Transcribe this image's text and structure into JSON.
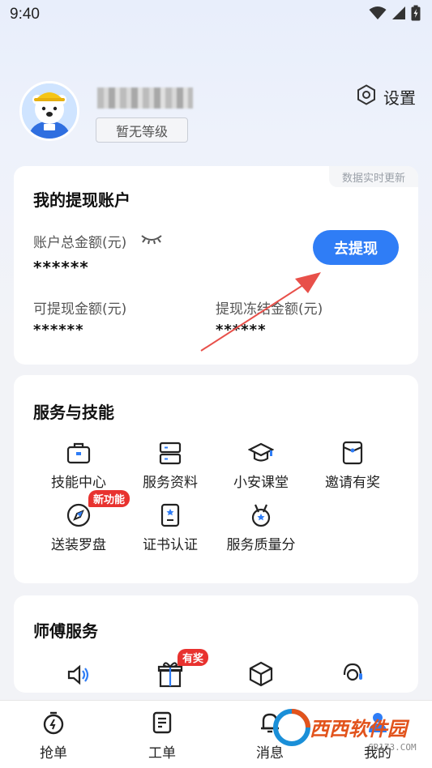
{
  "status_bar": {
    "time": "9:40"
  },
  "profile": {
    "level": "暂无等级",
    "settings_label": "设置"
  },
  "withdraw_account": {
    "title": "我的提现账户",
    "realtime_note": "数据实时更新",
    "total_label": "账户总金额(元)",
    "total_value": "******",
    "withdraw_button": "去提现",
    "available_label": "可提现金额(元)",
    "available_value": "******",
    "frozen_label": "提现冻结金额(元)",
    "frozen_value": "******"
  },
  "services": {
    "title": "服务与技能",
    "new_feature_tag": "新功能",
    "items": [
      {
        "label": "技能中心",
        "icon": "briefcase-icon"
      },
      {
        "label": "服务资料",
        "icon": "server-icon"
      },
      {
        "label": "小安课堂",
        "icon": "graduation-cap-icon"
      },
      {
        "label": "邀请有奖",
        "icon": "invite-card-icon"
      },
      {
        "label": "送装罗盘",
        "icon": "compass-icon"
      },
      {
        "label": "证书认证",
        "icon": "certificate-icon"
      },
      {
        "label": "服务质量分",
        "icon": "medal-icon"
      }
    ]
  },
  "master_services": {
    "title": "师傅服务",
    "award_tag": "有奖",
    "icons": [
      "speaker-icon",
      "gift-icon",
      "box-icon",
      "support-icon"
    ]
  },
  "bottom_nav": {
    "items": [
      {
        "label": "抢单",
        "icon": "timer-icon"
      },
      {
        "label": "工单",
        "icon": "document-icon"
      },
      {
        "label": "消息",
        "icon": "bell-icon"
      },
      {
        "label": "我的",
        "icon": "person-icon"
      }
    ]
  },
  "watermark": {
    "text": "西西软件园",
    "sub": "CR173.COM"
  },
  "colors": {
    "accent": "#2f7df6",
    "badge_red": "#e8322f",
    "annotation_arrow": "#e8504a"
  }
}
